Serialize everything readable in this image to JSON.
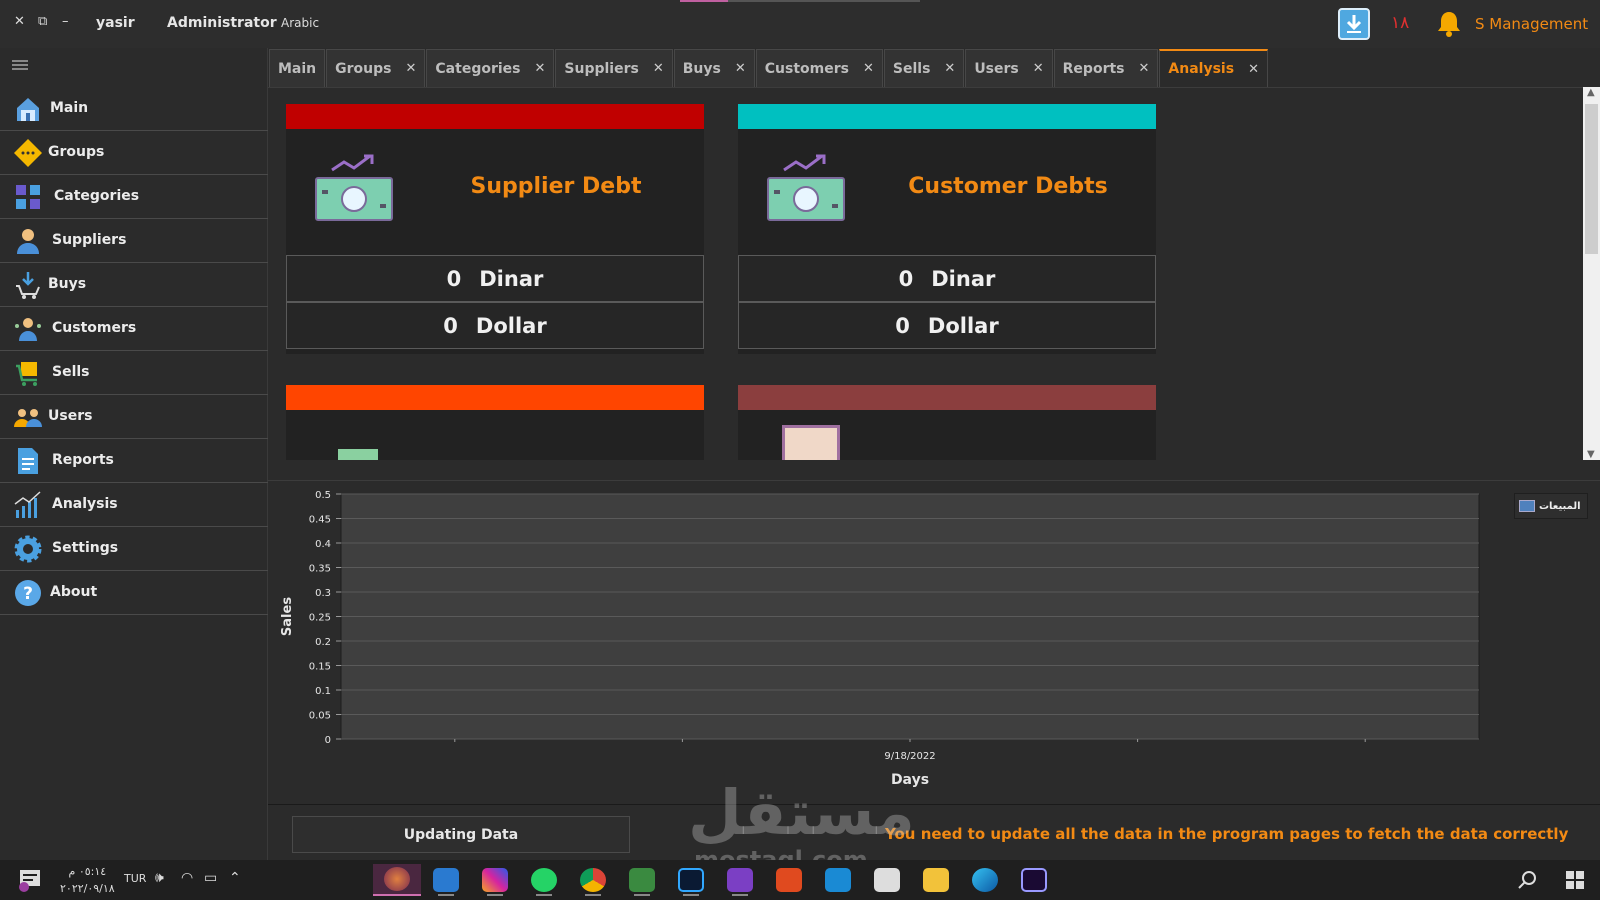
{
  "titlebar": {
    "user": "yasir",
    "role": "Administrator",
    "language": "Arabic",
    "notification_count": "١٨",
    "app_name": "S Management"
  },
  "sidebar": {
    "items": [
      {
        "label": "Main",
        "icon": "home-icon"
      },
      {
        "label": "Groups",
        "icon": "groups-icon"
      },
      {
        "label": "Categories",
        "icon": "categories-icon"
      },
      {
        "label": "Suppliers",
        "icon": "suppliers-icon"
      },
      {
        "label": "Buys",
        "icon": "cart-down-icon"
      },
      {
        "label": "Customers",
        "icon": "customers-icon"
      },
      {
        "label": "Sells",
        "icon": "sells-cart-icon"
      },
      {
        "label": "Users",
        "icon": "users-icon"
      },
      {
        "label": "Reports",
        "icon": "reports-icon"
      },
      {
        "label": "Analysis",
        "icon": "analysis-chart-icon"
      },
      {
        "label": "Settings",
        "icon": "gear-icon"
      },
      {
        "label": "About",
        "icon": "help-icon"
      }
    ]
  },
  "tabs": [
    {
      "label": "Main",
      "closable": false
    },
    {
      "label": "Groups",
      "closable": true
    },
    {
      "label": "Categories",
      "closable": true
    },
    {
      "label": "Suppliers",
      "closable": true
    },
    {
      "label": "Buys",
      "closable": true
    },
    {
      "label": "Customers",
      "closable": true
    },
    {
      "label": "Sells",
      "closable": true
    },
    {
      "label": "Users",
      "closable": true
    },
    {
      "label": "Reports",
      "closable": true
    },
    {
      "label": "Analysis",
      "closable": true,
      "active": true
    }
  ],
  "cards": [
    {
      "title": "Supplier Debt",
      "color": "#c00000",
      "rows": [
        {
          "value": "0",
          "unit": "Dinar"
        },
        {
          "value": "0",
          "unit": "Dollar"
        }
      ]
    },
    {
      "title": "Customer Debts",
      "color": "#00c0c0",
      "rows": [
        {
          "value": "0",
          "unit": "Dinar"
        },
        {
          "value": "0",
          "unit": "Dollar"
        }
      ]
    },
    {
      "title": "",
      "color": "#ff4500"
    },
    {
      "title": "",
      "color": "#8b3e3e"
    }
  ],
  "chart_data": {
    "type": "bar",
    "title": "",
    "xlabel": "Days",
    "ylabel": "Sales",
    "categories": [
      "9/18/2022"
    ],
    "series": [
      {
        "name": "المبيعات",
        "values": [
          0
        ],
        "color": "#4f81bd"
      }
    ],
    "yticks": [
      "0",
      "0.05",
      "0.1",
      "0.15",
      "0.2",
      "0.25",
      "0.3",
      "0.35",
      "0.4",
      "0.45",
      "0.5"
    ],
    "ylim": [
      0,
      0.5
    ],
    "grid": true,
    "legend": "top-right"
  },
  "footer": {
    "update_button": "Updating Data",
    "message": "You need to update all the data in the program pages to fetch the data correctly"
  },
  "watermark": {
    "arabic": "مستقل",
    "latin": "mostaql.com"
  },
  "taskbar": {
    "time": "٠٥:١٤ م",
    "date": "٢٠٢٢/٠٩/١٨",
    "language": "TUR"
  },
  "colors": {
    "accent": "#f28a14",
    "background": "#2b2b2b"
  }
}
